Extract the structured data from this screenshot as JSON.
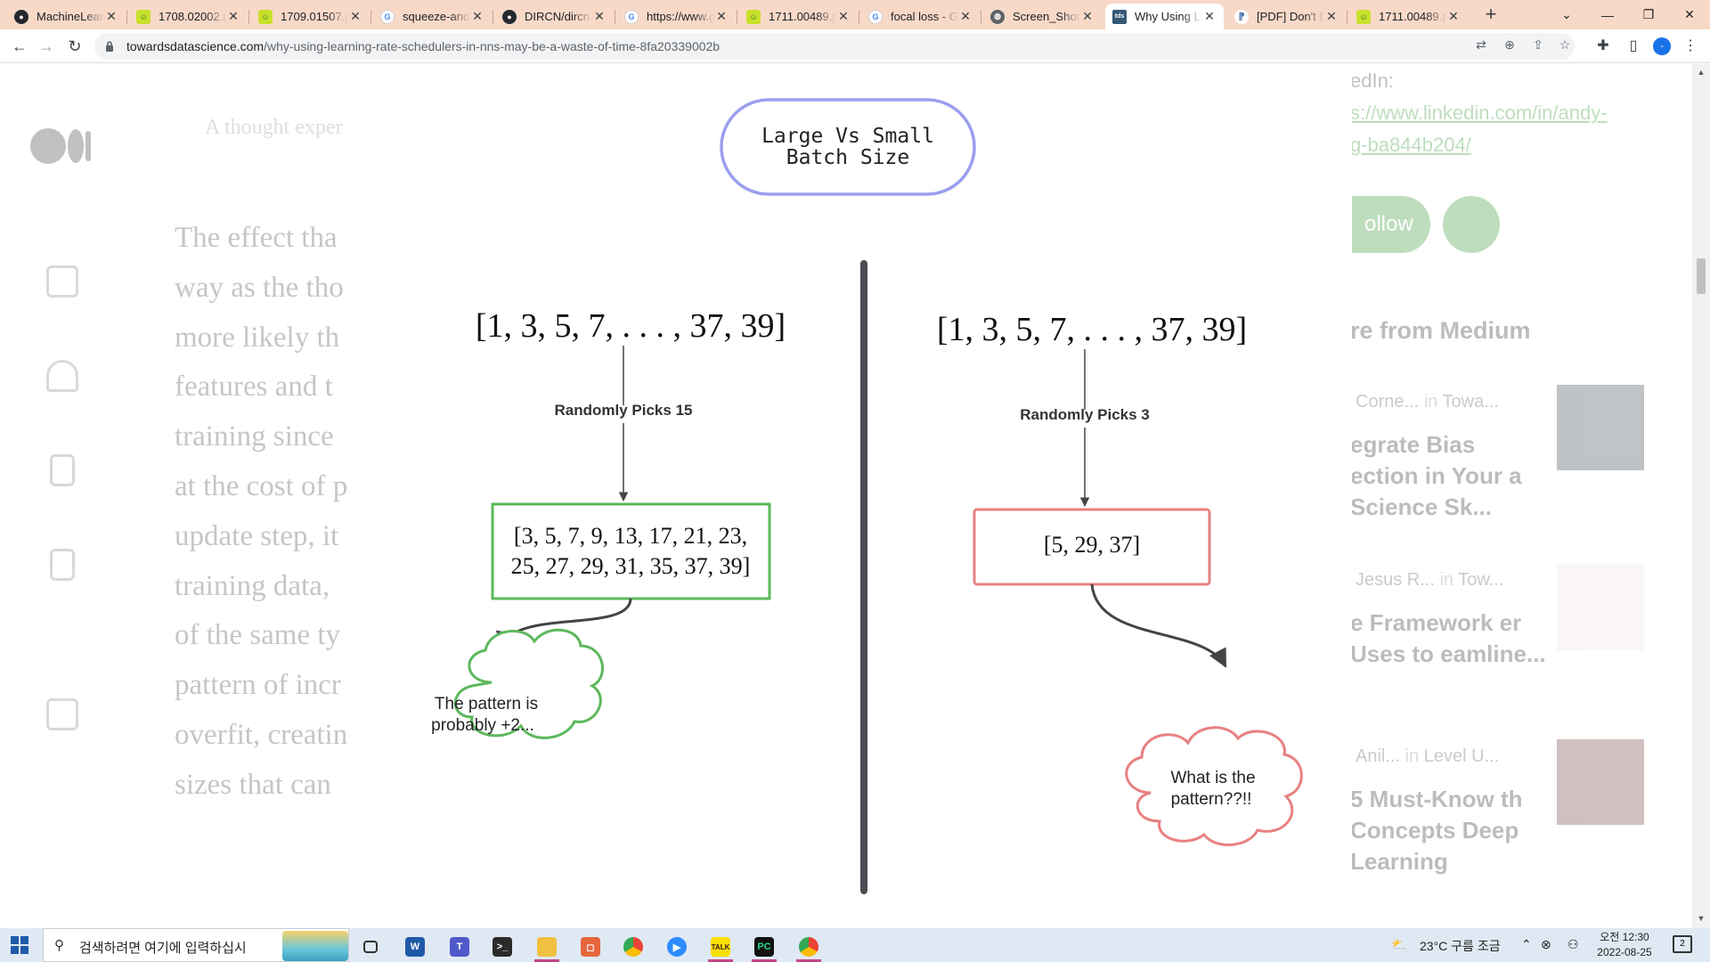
{
  "browser": {
    "tabs": [
      {
        "title": "MachineLearn",
        "icon": "github-icon"
      },
      {
        "title": "1708.02002.p",
        "icon": "pdf-icon"
      },
      {
        "title": "1709.01507.p",
        "icon": "pdf-icon"
      },
      {
        "title": "squeeze-and-",
        "icon": "google-icon"
      },
      {
        "title": "DIRCN/dircn.",
        "icon": "github-icon"
      },
      {
        "title": "https://www.g",
        "icon": "google-icon"
      },
      {
        "title": "1711.00489.p",
        "icon": "pdf-icon"
      },
      {
        "title": "focal loss - G",
        "icon": "google-icon"
      },
      {
        "title": "Screen_Shot_",
        "icon": "globe-icon"
      },
      {
        "title": "Why Using Le",
        "icon": "tds-icon",
        "active": true
      },
      {
        "title": "[PDF] Don't D",
        "icon": "scholar-icon"
      },
      {
        "title": "1711.00489.p",
        "icon": "pdf-icon"
      }
    ],
    "url_host": "towardsdatascience.com",
    "url_path": "/why-using-learning-rate-schedulers-in-nns-may-be-a-waste-of-time-8fa20339002b",
    "profile_initial": "-"
  },
  "article": {
    "subtitle": "A thought exper",
    "body_lines": [
      "The effect tha",
      "way as the tho",
      "more likely th",
      "features and t",
      "training since",
      "at the cost of p",
      "update step, it",
      "training data,",
      "of the same ty",
      "pattern of incr",
      "overfit, creatin",
      "sizes that can"
    ]
  },
  "sidebar": {
    "linkedin_label": "edIn:",
    "linkedin_url_1": "s://www.linkedin.com/in/andy-",
    "linkedin_url_2": "g-ba844b204/",
    "follow_label": "ollow",
    "more_from": "re from Medium",
    "stories": [
      {
        "author": "Corne...",
        "in": "in",
        "pub": "Towa...",
        "title": "egrate Bias ection in Your a Science Sk..."
      },
      {
        "author": "Jesus R...",
        "in": "in",
        "pub": "Tow...",
        "title": "e Framework er Uses to eamline..."
      },
      {
        "author": "Anil...",
        "in": "in",
        "pub": "Level U...",
        "title": "5 Must-Know th Concepts Deep Learning"
      }
    ]
  },
  "figure": {
    "title_line1": "Large Vs Small",
    "title_line2": "Batch Size",
    "left": {
      "sequence": "[1, 3, 5, 7, . . . , 37, 39]",
      "pick_label": "Randomly Picks 15",
      "sample_line1": "[3, 5, 7, 9, 13, 17, 21, 23,",
      "sample_line2": "25, 27, 29, 31, 35, 37, 39]",
      "thought_line1": "The pattern is",
      "thought_line2": "probably +2...",
      "color": "#5cb85c"
    },
    "right": {
      "sequence": "[1, 3, 5, 7, . . . , 37, 39]",
      "pick_label": "Randomly Picks 3",
      "sample_line1": "[5, 29, 37]",
      "thought_line1": "What is the",
      "thought_line2": "pattern??!!",
      "color": "#e88080"
    },
    "title_color": "#9a9ef0",
    "divider_color": "#4a4d52"
  },
  "taskbar": {
    "search_placeholder": "검색하려면 여기에 입력하십시",
    "weather": "23°C  구름 조금",
    "time": "오전 12:30",
    "date": "2022-08-25",
    "notif_count": "2",
    "apps": [
      "task-view-icon",
      "word-icon",
      "teams-icon",
      "terminal-icon",
      "file-explorer-icon",
      "app-orange-icon",
      "chrome-icon",
      "zoom-icon",
      "kakaotalk-icon",
      "pycharm-icon",
      "chrome-profile-icon"
    ]
  }
}
